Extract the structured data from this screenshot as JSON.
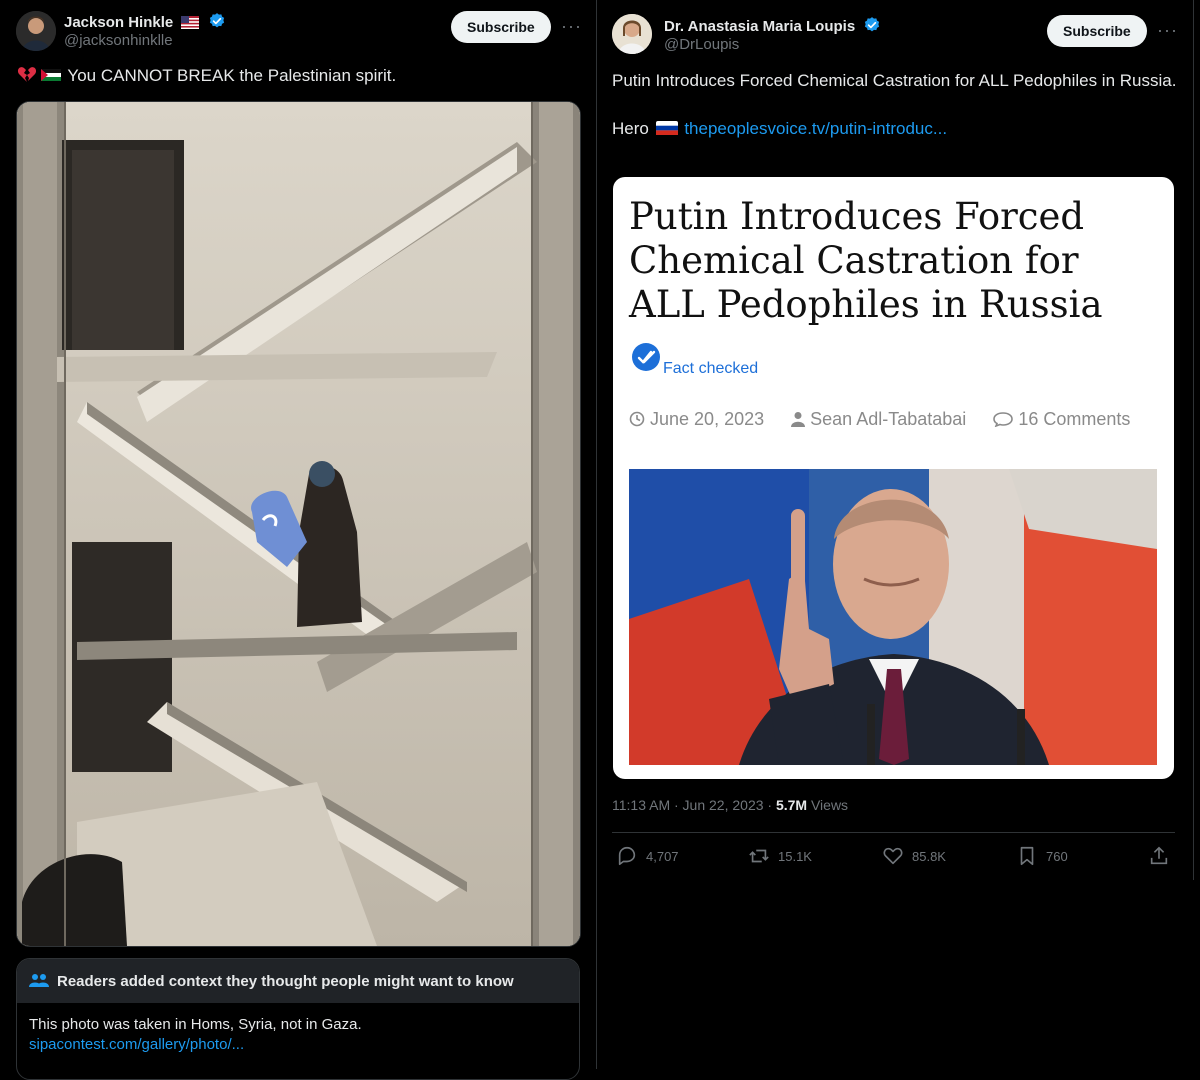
{
  "left_tweet": {
    "author_name": "Jackson Hinkle",
    "handle": "@jacksonhinklle",
    "subscribe_label": "Subscribe",
    "more_label": "···",
    "text": "You CANNOT BREAK the Palestinian spirit.",
    "community_note": {
      "header": "Readers added context they thought people might want to know",
      "body": "This photo was taken in Homs, Syria, not in Gaza.",
      "link": "sipacontest.com/gallery/photo/..."
    }
  },
  "right_tweet": {
    "author_name": "Dr. Anastasia Maria Loupis",
    "handle": "@DrLoupis",
    "subscribe_label": "Subscribe",
    "more_label": "···",
    "text_line1": "Putin Introduces Forced Chemical Castration for ALL Pedophiles in Russia.",
    "text_hero": "Hero",
    "text_link": "thepeoplesvoice.tv/putin-introduc...",
    "card": {
      "title": "Putin Introduces Forced Chemical Castration for ALL Pedophiles in Russia",
      "fact_checked": "Fact checked",
      "date": "June 20, 2023",
      "author": "Sean Adl-Tabatabai",
      "comments": "16 Comments"
    },
    "timestamp": "11:13 AM · Jun 22, 2023 · ",
    "views_count": "5.7M",
    "views_label": " Views",
    "actions": {
      "replies": "4,707",
      "reposts": "15.1K",
      "likes": "85.8K",
      "bookmarks": "760"
    }
  },
  "colors": {
    "accent": "#1d9bf0",
    "background": "#000000",
    "muted": "#71767b",
    "text": "#e7e9ea"
  }
}
